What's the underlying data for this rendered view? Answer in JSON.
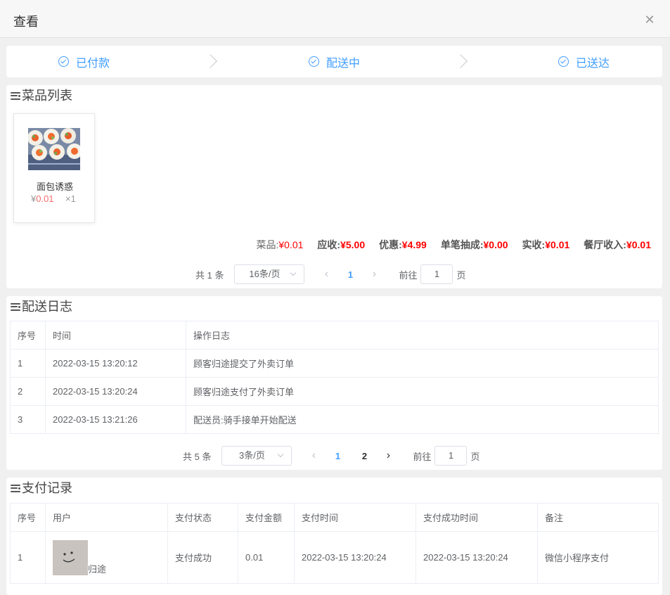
{
  "dialog": {
    "title": "查看",
    "close_icon": "close-icon"
  },
  "steps": [
    {
      "label": "已付款",
      "icon": "check-circle-icon"
    },
    {
      "label": "配送中",
      "icon": "check-circle-icon"
    },
    {
      "label": "已送达",
      "icon": "check-circle-icon"
    }
  ],
  "dishes": {
    "title": "菜品列表",
    "items": [
      {
        "name": "面包诱惑",
        "currency": "¥",
        "price": "0.01",
        "qty": "×1"
      }
    ],
    "summary": {
      "dish_label": "菜品:",
      "dish_value": "¥0.01",
      "receivable_label": "应收:",
      "receivable_value": "¥5.00",
      "discount_label": "优惠:",
      "discount_value": "¥4.99",
      "commission_label": "单笔抽成:",
      "commission_value": "¥0.00",
      "actual_label": "实收:",
      "actual_value": "¥0.01",
      "restaurant_label": "餐厅收入:",
      "restaurant_value": "¥0.01"
    },
    "pagination": {
      "total": "共 1 条",
      "page_size": "16条/页",
      "pages": [
        "1"
      ],
      "current": "1",
      "goto_label": "前往",
      "goto_value": "1",
      "page_suffix": "页"
    }
  },
  "delivery_log": {
    "title": "配送日志",
    "columns": [
      "序号",
      "时间",
      "操作日志"
    ],
    "rows": [
      [
        "1",
        "2022-03-15 13:20:12",
        "顾客归途提交了外卖订单"
      ],
      [
        "2",
        "2022-03-15 13:20:24",
        "顾客归途支付了外卖订单"
      ],
      [
        "3",
        "2022-03-15 13:21:26",
        "配送员:骑手接单开始配送"
      ]
    ],
    "pagination": {
      "total": "共 5 条",
      "page_size": "3条/页",
      "pages": [
        "1",
        "2"
      ],
      "current": "1",
      "goto_label": "前往",
      "goto_value": "1",
      "page_suffix": "页"
    }
  },
  "payment": {
    "title": "支付记录",
    "columns": [
      "序号",
      "用户",
      "支付状态",
      "支付金额",
      "支付时间",
      "支付成功时间",
      "备注"
    ],
    "rows": [
      {
        "index": "1",
        "user": "归途",
        "status": "支付成功",
        "amount": "0.01",
        "pay_time": "2022-03-15 13:20:24",
        "success_time": "2022-03-15 13:20:24",
        "remark": "微信小程序支付"
      }
    ]
  },
  "colors": {
    "primary": "#409eff",
    "money_red": "#f00"
  }
}
